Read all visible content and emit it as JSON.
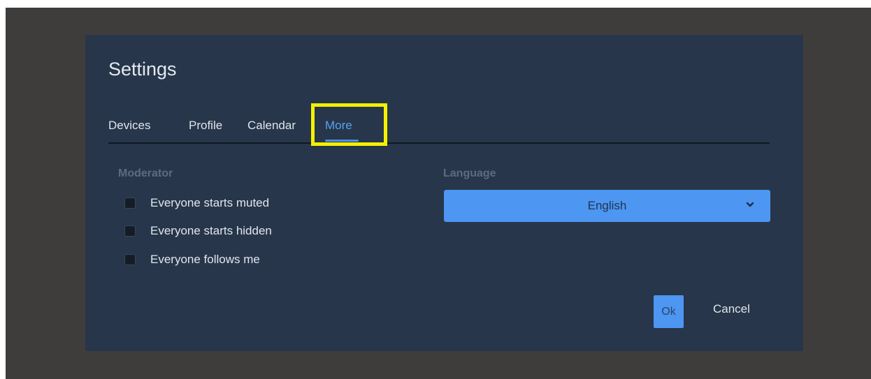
{
  "dialog": {
    "title": "Settings"
  },
  "tabs": [
    {
      "label": "Devices",
      "active": false
    },
    {
      "label": "Profile",
      "active": false
    },
    {
      "label": "Calendar",
      "active": false
    },
    {
      "label": "More",
      "active": true
    }
  ],
  "moderator": {
    "label": "Moderator",
    "options": [
      {
        "label": "Everyone starts muted",
        "checked": false
      },
      {
        "label": "Everyone starts hidden",
        "checked": false
      },
      {
        "label": "Everyone follows me",
        "checked": false
      }
    ]
  },
  "language": {
    "label": "Language",
    "selected": "English",
    "icon": "chevron-down-icon"
  },
  "actions": {
    "ok_label": "Ok",
    "cancel_label": "Cancel"
  },
  "colors": {
    "dialog_bg": "#27364a",
    "accent": "#4d96f1",
    "highlight": "#f3f000"
  }
}
